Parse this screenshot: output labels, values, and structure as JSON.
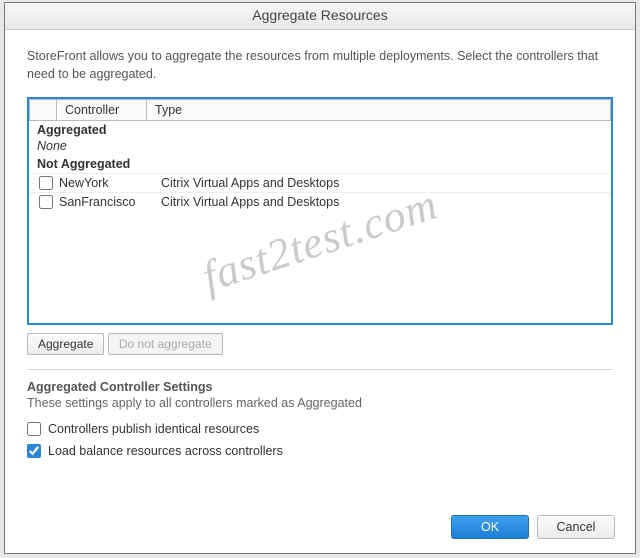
{
  "window": {
    "title": "Aggregate Resources"
  },
  "description": "StoreFront allows you to aggregate the resources from multiple deployments. Select the controllers that need to be aggregated.",
  "columns": {
    "controller": "Controller",
    "type": "Type"
  },
  "groups": {
    "aggregated_label": "Aggregated",
    "aggregated_none": "None",
    "not_aggregated_label": "Not Aggregated"
  },
  "rows": [
    {
      "checked": false,
      "controller": "NewYork",
      "type": "Citrix Virtual Apps and Desktops"
    },
    {
      "checked": false,
      "controller": "SanFrancisco",
      "type": "Citrix Virtual Apps and Desktops"
    }
  ],
  "buttons": {
    "aggregate": "Aggregate",
    "do_not_aggregate": "Do not aggregate",
    "ok": "OK",
    "cancel": "Cancel"
  },
  "settings": {
    "title": "Aggregated Controller Settings",
    "subtitle": "These settings apply to all controllers marked as Aggregated",
    "publish_identical": {
      "label": "Controllers publish identical resources",
      "checked": false
    },
    "load_balance": {
      "label": "Load balance resources across controllers",
      "checked": true
    }
  },
  "watermark": "fast2test.com"
}
